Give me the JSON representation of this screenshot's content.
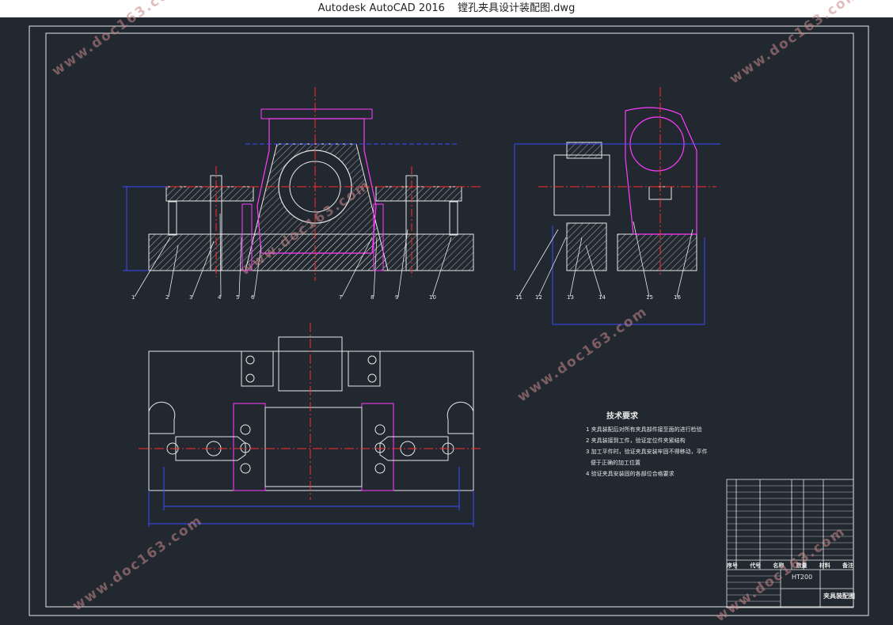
{
  "window": {
    "app_title": "Autodesk AutoCAD 2016",
    "file_name": "镗孔夹具设计装配图.dwg"
  },
  "drawing": {
    "tech_requirements_title": "技术要求",
    "tech_requirements": [
      "1 夹具装配后对所有夹具部件接至面的进行检验",
      "2 夹具装接到工件，验证定位件夹紧结构",
      "3 加工平件时，验证夹具安装牢固不得移动，平件",
      "   便于正确的加工位置",
      "4 验证夹具安装固的各部位合格要求"
    ],
    "title_block": {
      "drawing_code": "HT200",
      "drawing_name": "夹具装配图",
      "header_cols": [
        "序号",
        "代号",
        "名称",
        "数量",
        "材料",
        "备注"
      ]
    },
    "part_numbers_front": [
      "1",
      "2",
      "3",
      "4",
      "5",
      "6",
      "7",
      "8",
      "9",
      "10"
    ],
    "part_numbers_side": [
      "11",
      "12",
      "13",
      "14",
      "15",
      "16"
    ]
  },
  "watermark": {
    "text": "www.doc163.com"
  },
  "colors": {
    "background": "#212830",
    "white": "#e8e8e8",
    "blue": "#3a4cff",
    "red": "#ff2b2b",
    "magenta": "#ff3bff",
    "watermark": "#c98a8a"
  }
}
